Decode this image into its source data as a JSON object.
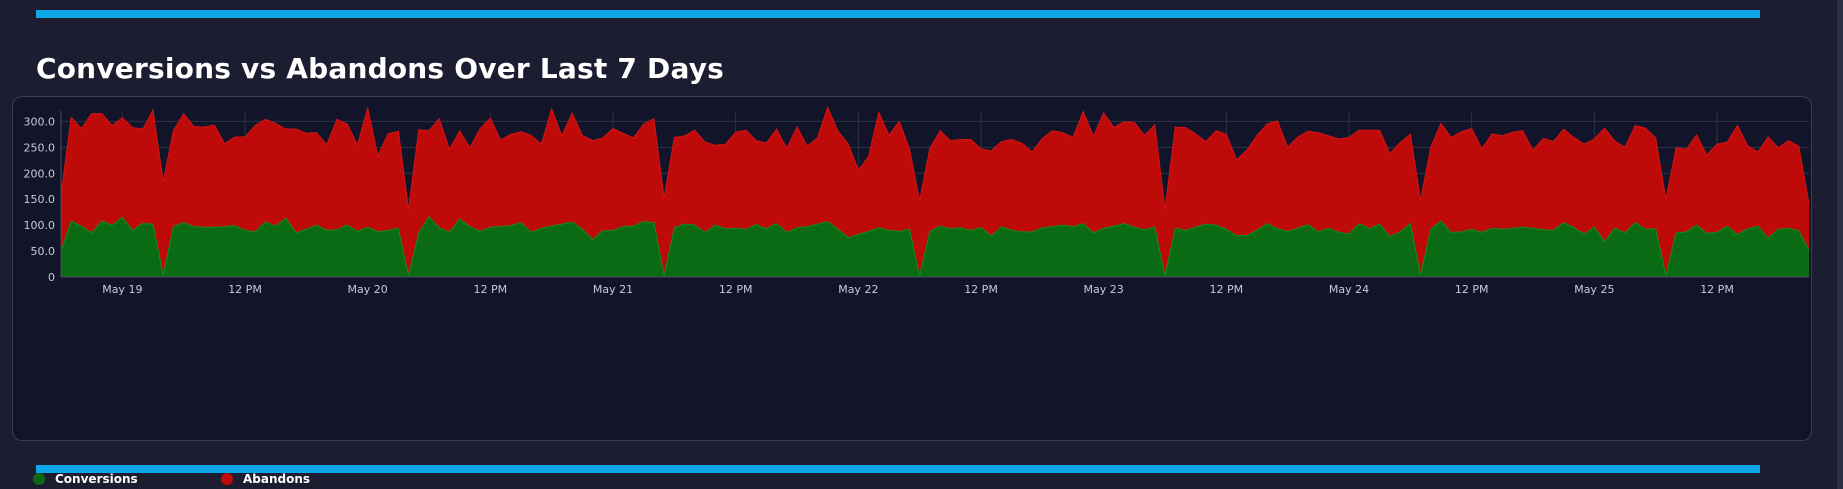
{
  "title": "Conversions vs Abandons Over Last 7 Days",
  "colors": {
    "background": "#1c1d30",
    "panel": "#12142a",
    "accent": "#0ea5e9",
    "conversions": "#0b6b14",
    "abandons": "#bf0a0a",
    "grid": "#2f3346",
    "tick_text": "#c7cad6"
  },
  "legend": {
    "conversions": "Conversions",
    "abandons": "Abandons"
  },
  "chart_data": {
    "type": "area",
    "stacked": true,
    "xlabel": "",
    "ylabel": "",
    "ylim": [
      0,
      320
    ],
    "y_ticks": [
      "0",
      "50.0",
      "100.0",
      "150.0",
      "200.0",
      "250.0",
      "300.0"
    ],
    "x_ticks": [
      "May 19",
      "12 PM",
      "May 20",
      "12 PM",
      "May 21",
      "12 PM",
      "May 22",
      "12 PM",
      "May 23",
      "12 PM",
      "May 24",
      "12 PM",
      "May 25",
      "12 PM"
    ],
    "x_range": [
      "May 18 18:00",
      "May 25 18:00"
    ],
    "interval_hours": 1,
    "grid": true,
    "legend_position": "bottom-left",
    "series": [
      {
        "name": "Conversions",
        "color": "#0b6b14",
        "values": [
          50,
          108,
          98,
          85,
          108,
          100,
          115,
          90,
          103,
          102,
          3,
          97,
          105,
          97,
          96,
          96,
          97,
          99,
          90,
          87,
          106,
          98,
          113,
          85,
          92,
          100,
          90,
          91,
          100,
          88,
          96,
          87,
          90,
          94,
          2,
          85,
          116,
          95,
          86,
          112,
          97,
          88,
          96,
          97,
          99,
          105,
          86,
          94,
          98,
          102,
          106,
          92,
          72,
          89,
          90,
          97,
          98,
          107,
          105,
          2,
          95,
          102,
          100,
          86,
          100,
          93,
          94,
          92,
          101,
          93,
          103,
          86,
          95,
          97,
          102,
          107,
          92,
          76,
          82,
          88,
          95,
          90,
          88,
          92,
          2,
          88,
          98,
          93,
          95,
          90,
          95,
          79,
          97,
          90,
          87,
          87,
          95,
          97,
          100,
          97,
          103,
          85,
          94,
          98,
          103,
          96,
          91,
          96,
          2,
          94,
          90,
          96,
          102,
          100,
          92,
          80,
          80,
          90,
          103,
          93,
          88,
          94,
          101,
          87,
          94,
          86,
          83,
          103,
          93,
          102,
          78,
          87,
          103,
          4,
          92,
          108,
          86,
          87,
          92,
          86,
          94,
          92,
          94,
          96,
          94,
          91,
          90,
          105,
          95,
          83,
          96,
          68,
          94,
          85,
          105,
          92,
          93,
          3,
          85,
          87,
          100,
          84,
          86,
          98,
          82,
          93,
          98,
          75,
          92,
          94,
          89,
          52
        ],
        "note": ""
      },
      {
        "name": "Abandons",
        "color": "#bf0a0a",
        "values": [
          108,
          200,
          188,
          230,
          207,
          192,
          192,
          198,
          182,
          220,
          180,
          185,
          210,
          193,
          193,
          197,
          160,
          171,
          180,
          205,
          198,
          198,
          172,
          200,
          185,
          178,
          165,
          213,
          195,
          166,
          230,
          146,
          186,
          187,
          128,
          199,
          166,
          210,
          160,
          170,
          152,
          198,
          210,
          167,
          176,
          175,
          187,
          162,
          226,
          170,
          210,
          181,
          191,
          179,
          196,
          180,
          170,
          188,
          200,
          150,
          174,
          170,
          183,
          174,
          154,
          163,
          185,
          191,
          162,
          165,
          182,
          162,
          194,
          155,
          166,
          220,
          189,
          181,
          124,
          144,
          222,
          183,
          212,
          155,
          145,
          160,
          184,
          170,
          170,
          175,
          152,
          164,
          164,
          175,
          171,
          154,
          172,
          185,
          178,
          172,
          216,
          186,
          222,
          190,
          196,
          202,
          182,
          197,
          128,
          195,
          198,
          180,
          159,
          182,
          183,
          146,
          164,
          183,
          192,
          208,
          162,
          176,
          180,
          191,
          178,
          180,
          186,
          180,
          190,
          181,
          160,
          172,
          172,
          144,
          158,
          188,
          183,
          193,
          194,
          161,
          182,
          180,
          185,
          186,
          150,
          176,
          171,
          180,
          174,
          173,
          170,
          219,
          168,
          165,
          187,
          195,
          175,
          147,
          164,
          159,
          174,
          151,
          170,
          162,
          210,
          160,
          143,
          195,
          157,
          169,
          163,
          89
        ]
      }
    ]
  }
}
